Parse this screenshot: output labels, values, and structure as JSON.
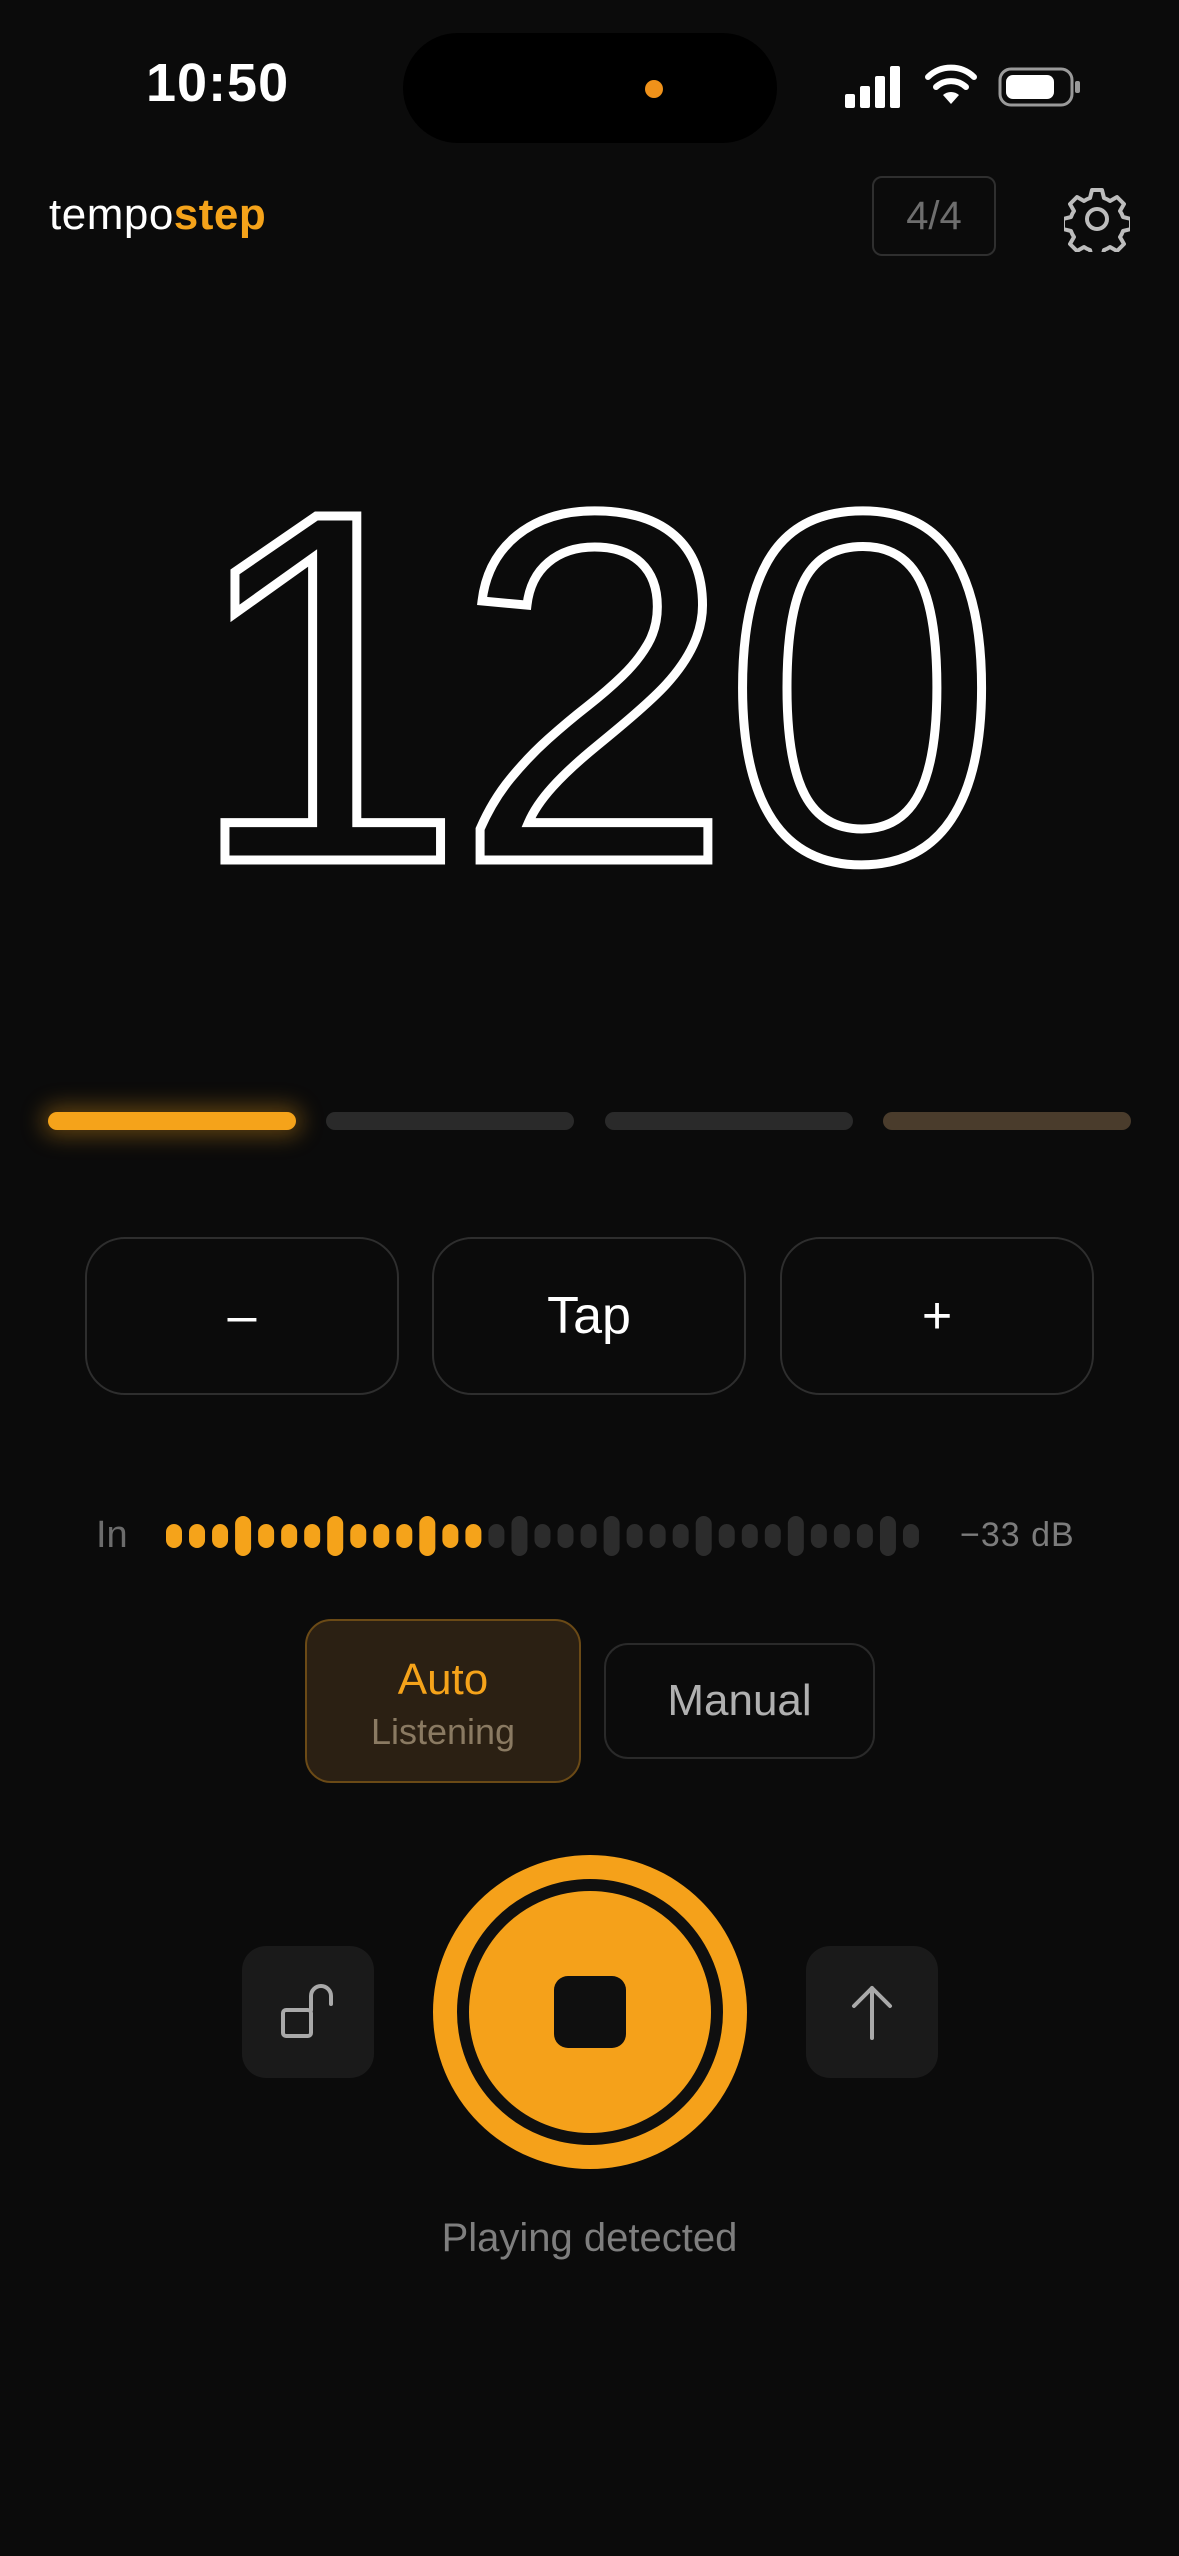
{
  "status_bar": {
    "time": "10:50"
  },
  "header": {
    "brand_part1": "tempo",
    "brand_part2": "step",
    "time_signature": "4/4"
  },
  "tempo": {
    "bpm": "120"
  },
  "beats": {
    "count": 4,
    "active": 1
  },
  "controls": {
    "minus_label": "–",
    "tap_label": "Tap",
    "plus_label": "+"
  },
  "input_meter": {
    "label": "In",
    "db_value": "−33  dB",
    "level_fraction": 0.43
  },
  "mode": {
    "auto_label": "Auto",
    "auto_sublabel": "Listening",
    "manual_label": "Manual",
    "selected": "Auto"
  },
  "transport": {
    "status_text": "Playing detected"
  },
  "colors": {
    "accent": "#f5a31a",
    "background": "#0b0b0b"
  },
  "icons": [
    "signal-icon",
    "wifi-icon",
    "battery-icon",
    "gear-icon",
    "unlock-icon",
    "stop-icon",
    "arrow-up-icon"
  ]
}
